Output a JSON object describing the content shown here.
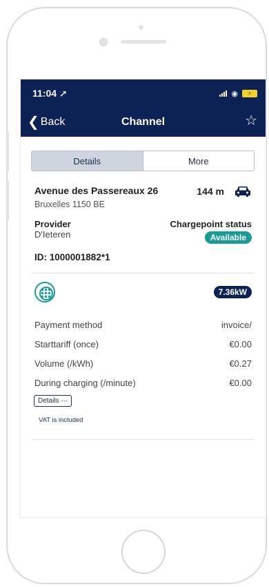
{
  "status": {
    "time": "11:04",
    "battery": "⚡"
  },
  "nav": {
    "back_label": "Back",
    "title": "Channel"
  },
  "tabs": [
    {
      "label": "Details",
      "active": true
    },
    {
      "label": "More",
      "active": false
    }
  ],
  "location": {
    "street": "Avenue des Passereaux 26",
    "city": "Bruxelles 1150 BE",
    "distance": "144 m"
  },
  "provider": {
    "label": "Provider",
    "value": "D'Ieteren",
    "status_label": "Chargepoint status",
    "status_value": "Available"
  },
  "id_line": "ID:  1000001882*1",
  "connector": {
    "power": "7.36kW"
  },
  "tariffs": [
    {
      "label": "Payment method",
      "value": "invoice/"
    },
    {
      "label": "Starttariff (once)",
      "value": "€0.00"
    },
    {
      "label": "Volume (/kWh)",
      "value": "€0.27"
    },
    {
      "label": "During charging (/minute)",
      "value": "€0.00"
    }
  ],
  "details_button": "Details ···",
  "vat_note": "VAT is included",
  "colors": {
    "nav": "#0c2255",
    "accent": "#1a9b96"
  }
}
